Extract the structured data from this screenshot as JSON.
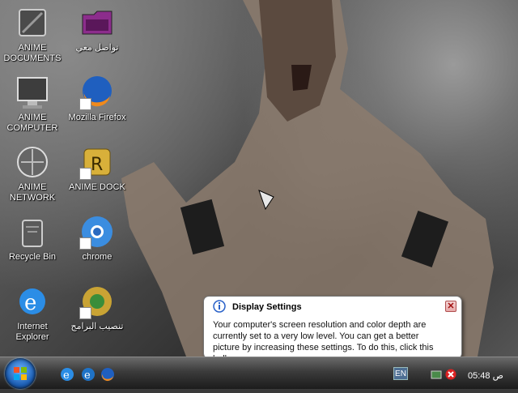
{
  "desktop": {
    "icons": [
      {
        "label": "ANIME DOCUMENTS",
        "icon": "folder-icon"
      },
      {
        "label": "تواصل معي",
        "icon": "folder-icon"
      },
      {
        "label": "ANIME COMPUTER",
        "icon": "monitor-icon"
      },
      {
        "label": "Mozilla Firefox",
        "icon": "firefox-icon"
      },
      {
        "label": "ANIME NETWORK",
        "icon": "network-icon"
      },
      {
        "label": "ANIME DOCK",
        "icon": "dock-icon"
      },
      {
        "label": "Recycle Bin",
        "icon": "recycle-bin-icon"
      },
      {
        "label": "chrome",
        "icon": "chrome-icon"
      },
      {
        "label": "Internet Explorer",
        "icon": "ie-icon"
      },
      {
        "label": "تنصيب البرامج",
        "icon": "installer-icon"
      }
    ]
  },
  "balloon": {
    "title": "Display Settings",
    "body": "Your computer's screen resolution and color depth are currently set to a very low level. You can get a better picture by increasing these settings. To do this, click this balloon.",
    "close": "✕"
  },
  "taskbar": {
    "language": "EN",
    "clock": "05:48 ص",
    "pinned": [
      "ie-icon",
      "ie-icon",
      "firefox-icon"
    ]
  },
  "colors": {
    "taskbar_top": "#6a6a6a",
    "taskbar_bottom": "#1c1c1c",
    "balloon_bg": "#ffffff"
  }
}
